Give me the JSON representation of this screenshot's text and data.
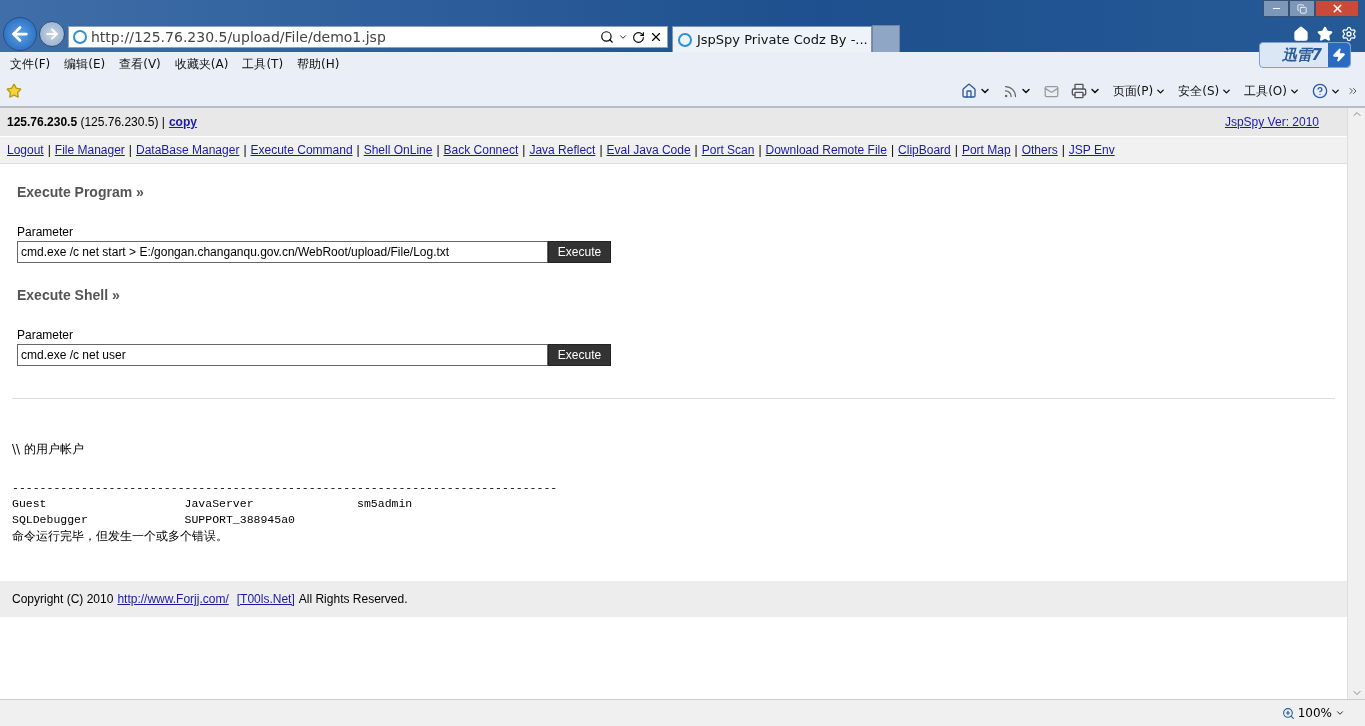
{
  "browser": {
    "address": "http://125.76.230.5/upload/File/demo1.jsp",
    "tab": {
      "title": "JspSpy Private Codz By -...",
      "selected": true
    },
    "addon": {
      "label": "迅雷7"
    },
    "menu": [
      "文件(F)",
      "编辑(E)",
      "查看(V)",
      "收藏夹(A)",
      "工具(T)",
      "帮助(H)"
    ],
    "commands": [
      "页面(P)",
      "安全(S)",
      "工具(O)"
    ],
    "zoom": "100%"
  },
  "page": {
    "host": "**125.76.230.5** (125.76.230.5) |",
    "copy_link": "copy",
    "version_link": "JspSpy Ver: 2010",
    "nav_separator": "|",
    "nav": [
      "Logout",
      "File Manager",
      "DataBase Manager",
      "Execute Command",
      "Shell OnLine",
      "Back Connect",
      "Java Reflect",
      "Eval Java Code",
      "Port Scan",
      "Download Remote File",
      "ClipBoard",
      "Port Map",
      "Others",
      "JSP Env"
    ],
    "sections": [
      {
        "title": "Execute Program »",
        "label": "Parameter",
        "value": "cmd.exe /c net start > E:/gongan.changanqu.gov.cn/WebRoot/upload/File/Log.txt",
        "button": "Execute"
      },
      {
        "title": "Execute Shell »",
        "label": "Parameter",
        "value": "cmd.exe /c net user",
        "button": "Execute"
      }
    ],
    "output": {
      "heading": "\\\\ 的用户帐户",
      "lines": [
        "-------------------------------------------------------------------------------",
        "Guest                    JavaServer               sm5admin",
        "SQLDebugger              SUPPORT_388945a0"
      ],
      "result": "命令运行完毕，但发生一个或多个错误。"
    },
    "footer": {
      "text_before": "Copyright (C) 2010",
      "link1": "http://www.Forjj.com/",
      "link2": "[T00ls.Net]",
      "text_after": "All Rights Reserved."
    }
  }
}
